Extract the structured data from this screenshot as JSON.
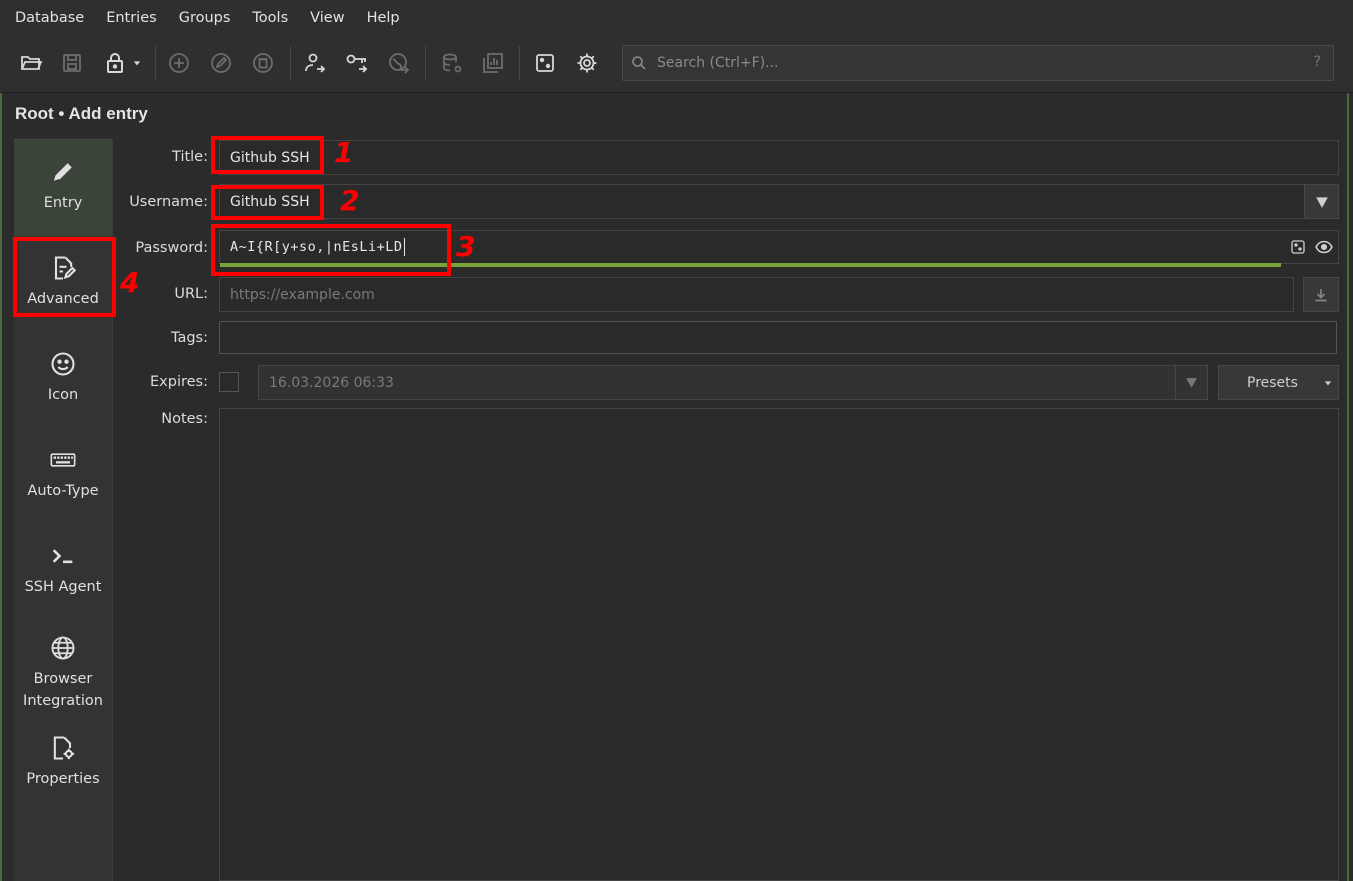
{
  "menu": [
    "Database",
    "Entries",
    "Groups",
    "Tools",
    "View",
    "Help"
  ],
  "toolbar": {
    "icons": [
      "open-database-icon",
      "save-database-icon",
      "lock-database-icon",
      "dropdown-arrow-icon",
      "add-entry-icon",
      "edit-entry-icon",
      "delete-entry-icon",
      "copy-username-icon",
      "copy-password-icon",
      "copy-url-icon",
      "database-settings-icon",
      "reports-icon",
      "password-generator-icon",
      "settings-icon"
    ],
    "search_placeholder": "Search (Ctrl+F)...",
    "search_help": "?"
  },
  "breadcrumb": "Root • Add entry",
  "sidebar": {
    "items": [
      {
        "label": "Entry",
        "icon": "pencil-icon",
        "active": true
      },
      {
        "label": "Advanced",
        "icon": "document-edit-icon"
      },
      {
        "label": "Icon",
        "icon": "smiley-icon"
      },
      {
        "label": "Auto-Type",
        "icon": "keyboard-icon"
      },
      {
        "label": "SSH Agent",
        "icon": "terminal-icon"
      },
      {
        "label": "Browser\nIntegration",
        "line1": "Browser",
        "line2": "Integration",
        "icon": "globe-icon"
      },
      {
        "label": "Properties",
        "icon": "document-gear-icon"
      }
    ]
  },
  "form": {
    "title_label": "Title:",
    "title_value": "Github SSH",
    "username_label": "Username:",
    "username_value": "Github SSH",
    "password_label": "Password:",
    "password_value": "A~I{R[y+so,|nEsLi+LD",
    "password_strength": 0.95,
    "url_label": "URL:",
    "url_placeholder": "https://example.com",
    "tags_label": "Tags:",
    "tags_value": "",
    "expires_label": "Expires:",
    "expires_value": "16.03.2026 06:33",
    "presets_label": "Presets",
    "notes_label": "Notes:",
    "notes_value": ""
  },
  "annotations": [
    "1",
    "2",
    "3",
    "4"
  ],
  "colors": {
    "annotation": "#ff0000",
    "strength_bar": "#7aa33a",
    "active_sidebar": "#3a4438"
  }
}
